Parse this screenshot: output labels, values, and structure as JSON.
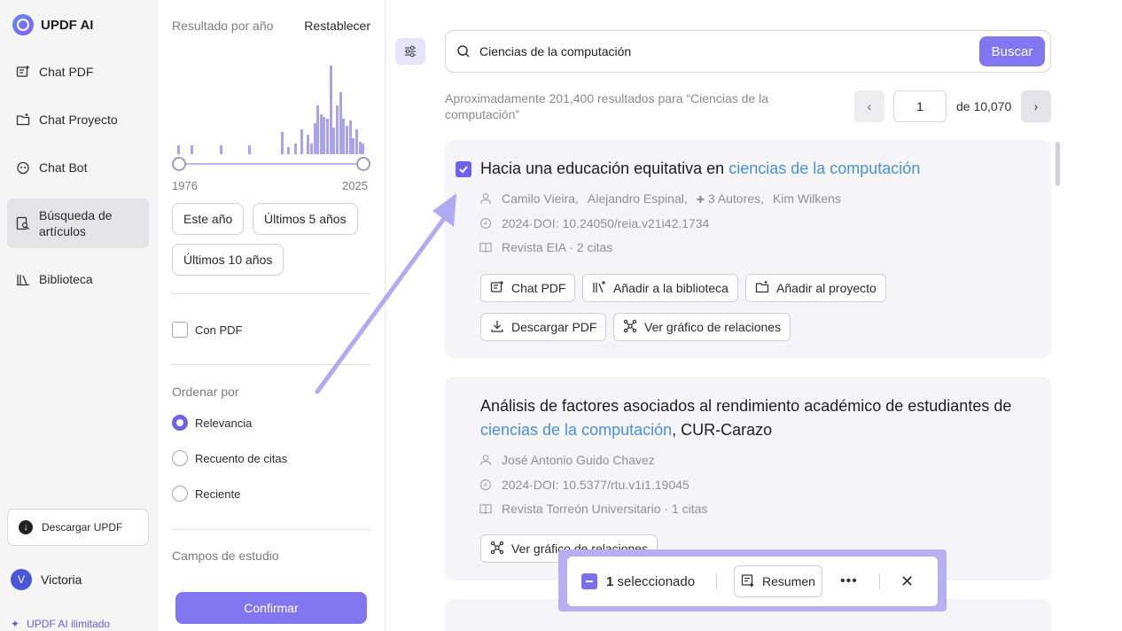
{
  "app": {
    "name": "UPDF AI"
  },
  "nav": {
    "items": [
      {
        "label": "Chat PDF",
        "icon": "chat-pdf-icon"
      },
      {
        "label": "Chat Proyecto",
        "icon": "folder-icon"
      },
      {
        "label": "Chat Bot",
        "icon": "bot-icon"
      },
      {
        "label": "Búsqueda de artículos",
        "icon": "article-search-icon",
        "active": true
      },
      {
        "label": "Biblioteca",
        "icon": "library-icon"
      }
    ],
    "download_label": "Descargar UPDF",
    "user_name": "Victoria",
    "user_initial": "V",
    "unlimited_label": "UPDF AI ilimitado"
  },
  "filters": {
    "year_title": "Resultado por año",
    "reset_label": "Restablecer",
    "year_min": "1976",
    "year_max": "2025",
    "histogram_values": [
      10,
      0,
      0,
      0,
      10,
      0,
      0,
      0,
      0,
      0,
      0,
      0,
      0,
      10,
      0,
      0,
      0,
      0,
      0,
      0,
      0,
      0,
      10,
      0,
      0,
      0,
      0,
      0,
      0,
      0,
      0,
      0,
      25,
      0,
      8,
      0,
      12,
      0,
      28,
      0,
      22,
      12,
      35,
      55,
      45,
      42,
      40,
      100,
      30,
      55,
      70,
      40,
      32,
      38,
      18,
      28,
      14,
      12
    ],
    "chips": [
      "Este año",
      "Últimos 5 años",
      "Últimos 10 años"
    ],
    "with_pdf_label": "Con PDF",
    "sort_title": "Ordenar por",
    "sort_options": [
      "Relevancia",
      "Recuento de citas",
      "Reciente"
    ],
    "sort_selected": 0,
    "fields_title": "Campos de estudio",
    "confirm_label": "Confirmar"
  },
  "search": {
    "query": "Ciencias de la computación",
    "button_label": "Buscar",
    "results_text": "Aproximadamente 201,400 resultados para “Ciencias de la computación”",
    "page": "1",
    "page_total": "de 10,070"
  },
  "results": [
    {
      "title_prefix": "Hacia una educación equitativa en ",
      "title_highlight": "ciencias de la computación",
      "title_suffix": "",
      "authors_a": "Camilo Vieira,",
      "authors_b": "Alejandro Espinal,",
      "authors_more": "3 Autores,",
      "authors_c": "Kim Wilkens",
      "doi": "2024·DOI: 10.24050/reia.v21i42.1734",
      "journal": "Revista EIA · 2 citas",
      "actions": [
        "Chat PDF",
        "Añadir a la biblioteca",
        "Añadir al proyecto",
        "Descargar PDF",
        "Ver gráfico de relaciones"
      ],
      "selected": true
    },
    {
      "title_prefix": "Análisis de factores asociados al rendimiento académico de estudiantes de ",
      "title_highlight": "ciencias de la computación",
      "title_suffix": ", CUR-Carazo",
      "authors": "José Antonio Guido Chavez",
      "doi": "2024·DOI: 10.5377/rtu.v1i1.19045",
      "journal": "Revista Torreón Universitario · 1 citas",
      "actions": [
        "Ver gráfico de relaciones"
      ]
    }
  ],
  "selection_bar": {
    "count": "1",
    "label": "seleccionado",
    "summary_label": "Resumen"
  }
}
